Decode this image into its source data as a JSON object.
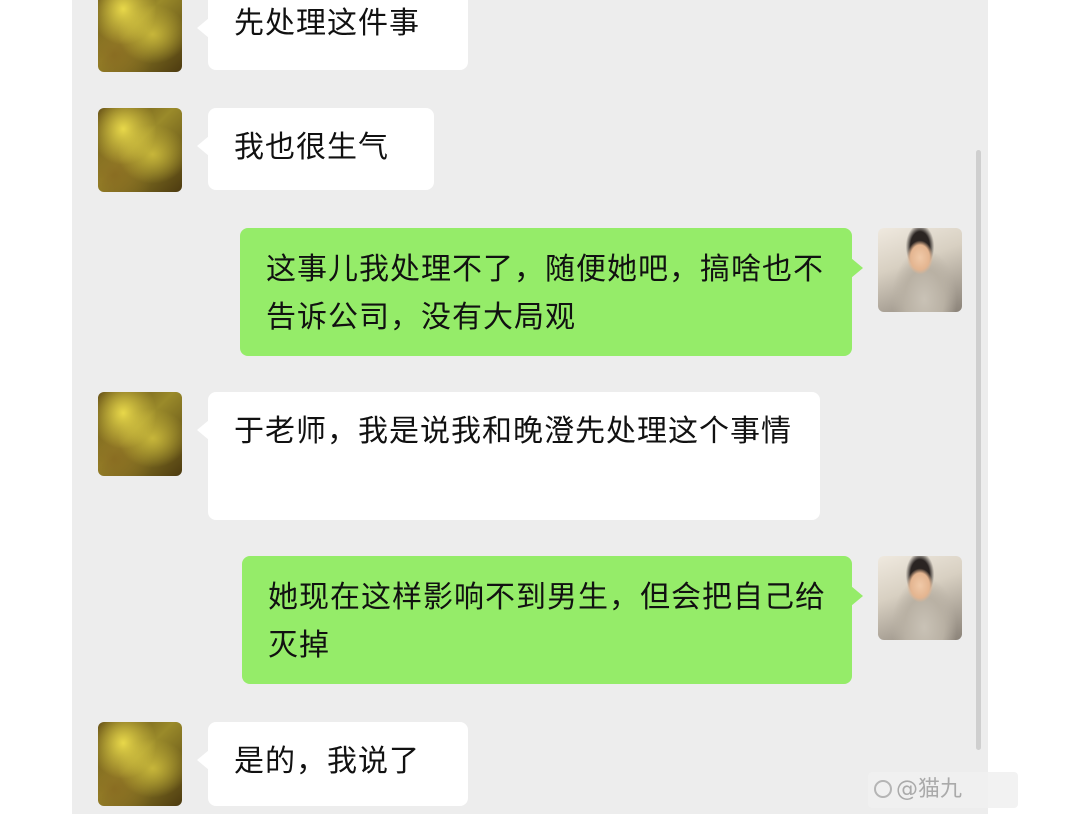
{
  "messages": [
    {
      "side": "them",
      "text": "先处理这件事"
    },
    {
      "side": "them",
      "text": "我也很生气"
    },
    {
      "side": "me",
      "text": "这事儿我处理不了，随便她吧，搞啥也不告诉公司，没有大局观"
    },
    {
      "side": "them",
      "text": "于老师，我是说我和晚澄先处理这个事情"
    },
    {
      "side": "me",
      "text": "她现在这样影响不到男生，但会把自己给灭掉"
    },
    {
      "side": "them",
      "text": "是的，我说了"
    }
  ],
  "watermark": {
    "text": "@猫九"
  },
  "colors": {
    "chat_background": "#ededed",
    "incoming_bubble": "#ffffff",
    "outgoing_bubble": "#95ec69"
  }
}
